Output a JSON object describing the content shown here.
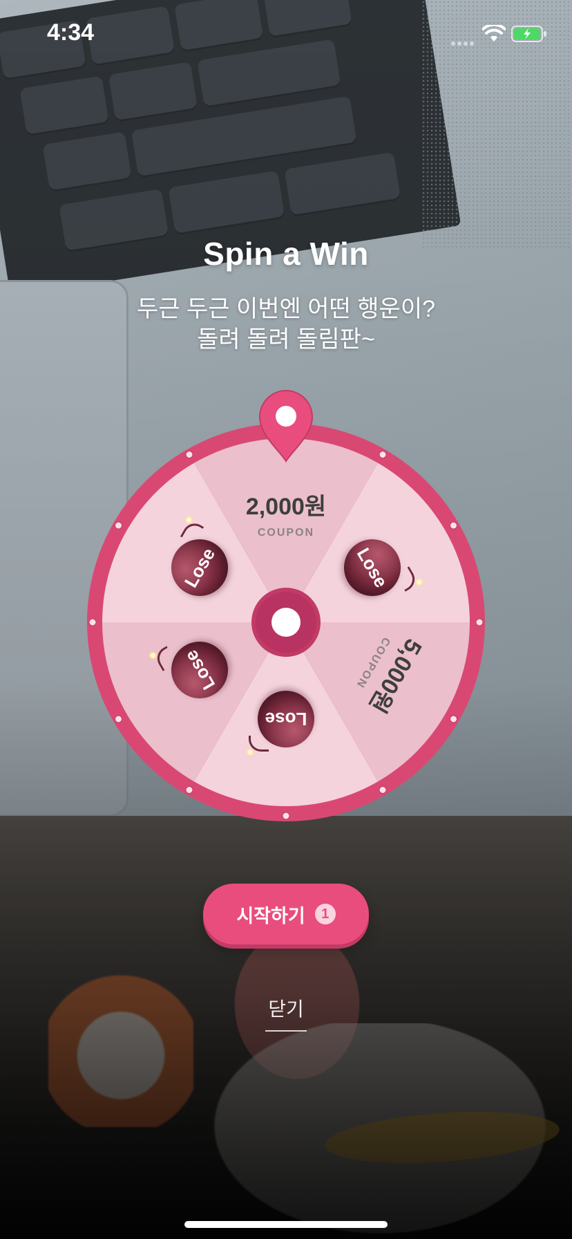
{
  "status_bar": {
    "time": "4:34"
  },
  "header": {
    "title": "Spin a Win",
    "subtitle_line1": "두근 두근 이번엔 어떤 행운이?",
    "subtitle_line2": "돌려 돌려 돌림판~"
  },
  "wheel": {
    "segments": [
      {
        "type": "prize",
        "amount": "2,000원",
        "label": "COUPON"
      },
      {
        "type": "lose",
        "label": "Lose"
      },
      {
        "type": "prize",
        "amount": "5,000원",
        "label": "COUPON"
      },
      {
        "type": "lose",
        "label": "Lose"
      },
      {
        "type": "lose",
        "label": "Lose"
      },
      {
        "type": "lose",
        "label": "Lose"
      }
    ]
  },
  "actions": {
    "start_label": "시작하기",
    "start_count": "1",
    "close_label": "닫기"
  },
  "colors": {
    "accent": "#e94d7e",
    "wheel_rim": "#d94873",
    "segment_light": "#f4d3dc",
    "segment_dark": "#ebbfcc"
  }
}
